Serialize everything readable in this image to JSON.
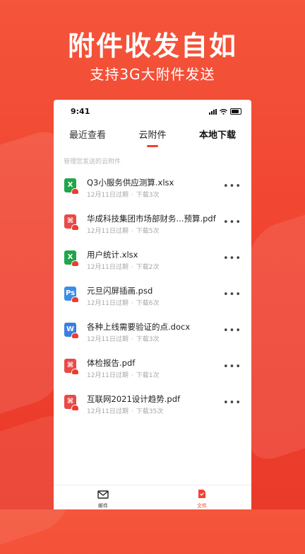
{
  "promo": {
    "title": "附件收发自如",
    "subtitle": "支持3G大附件发送"
  },
  "status_bar": {
    "time": "9:41"
  },
  "tabs": [
    {
      "label": "最近查看"
    },
    {
      "label": "云附件"
    },
    {
      "label": "本地下载"
    }
  ],
  "section_label": "管理您发送的云附件",
  "files": [
    {
      "name": "Q3小服务供应测算.xlsx",
      "expiry": "12月11日过期",
      "downloads": "下载3次",
      "icon": "excel-icon",
      "icon_letter": "X",
      "color": "#1fa64a"
    },
    {
      "name": "华成科技集团市场部财务...预算.pdf",
      "expiry": "12月11日过期",
      "downloads": "下载5次",
      "icon": "pdf-icon",
      "icon_letter": "⌘",
      "color": "#e94a47"
    },
    {
      "name": "用户统计.xlsx",
      "expiry": "12月11日过期",
      "downloads": "下载2次",
      "icon": "excel-icon",
      "icon_letter": "X",
      "color": "#1fa64a"
    },
    {
      "name": "元旦闪屏插画.psd",
      "expiry": "12月11日过期",
      "downloads": "下载6次",
      "icon": "photoshop-icon",
      "icon_letter": "Ps",
      "color": "#3b8ee8"
    },
    {
      "name": "各种上线需要验证的点.docx",
      "expiry": "12月11日过期",
      "downloads": "下载3次",
      "icon": "word-icon",
      "icon_letter": "W",
      "color": "#3a7fe0"
    },
    {
      "name": "体检报告.pdf",
      "expiry": "12月11日过期",
      "downloads": "下载1次",
      "icon": "pdf-icon",
      "icon_letter": "⌘",
      "color": "#e94a47"
    },
    {
      "name": "互联网2021设计趋势.pdf",
      "expiry": "12月11日过期",
      "downloads": "下载35次",
      "icon": "pdf-icon",
      "icon_letter": "⌘",
      "color": "#e94a47"
    }
  ],
  "more_glyph": "•••",
  "meta_separator": "·",
  "bottom_nav": [
    {
      "label": "邮件",
      "icon": "mail-icon"
    },
    {
      "label": "文件",
      "icon": "file-icon"
    }
  ],
  "colors": {
    "accent": "#f0412f"
  }
}
